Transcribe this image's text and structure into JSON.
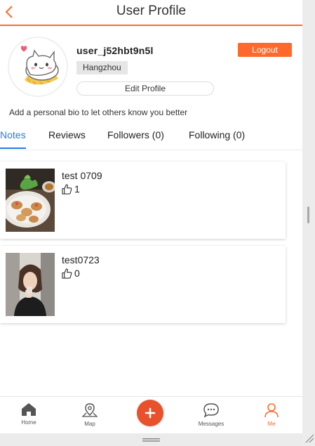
{
  "header": {
    "title": "User Profile",
    "back_icon": "chevron-left-icon"
  },
  "profile": {
    "username": "user_j52hbt9n5l",
    "city": "Hangzhou",
    "logout_label": "Logout",
    "edit_label": "Edit Profile",
    "bio": "Add a personal bio to let others know you better"
  },
  "tabs": [
    {
      "label": "Notes",
      "active": true
    },
    {
      "label": "Reviews",
      "active": false
    },
    {
      "label": "Followers (0)",
      "active": false
    },
    {
      "label": "Following (0)",
      "active": false
    }
  ],
  "notes": [
    {
      "title": "test 0709",
      "likes": "1",
      "thumb": "food-plate-photo"
    },
    {
      "title": "test0723",
      "likes": "0",
      "thumb": "person-selfie-photo"
    }
  ],
  "nav": {
    "home": "Home",
    "map": "Map",
    "messages": "Messages",
    "me": "Me",
    "add_icon": "plus-icon"
  },
  "colors": {
    "accent": "#ff6a2c",
    "add_button": "#e8512b",
    "tab_active": "#2a7ae2"
  }
}
